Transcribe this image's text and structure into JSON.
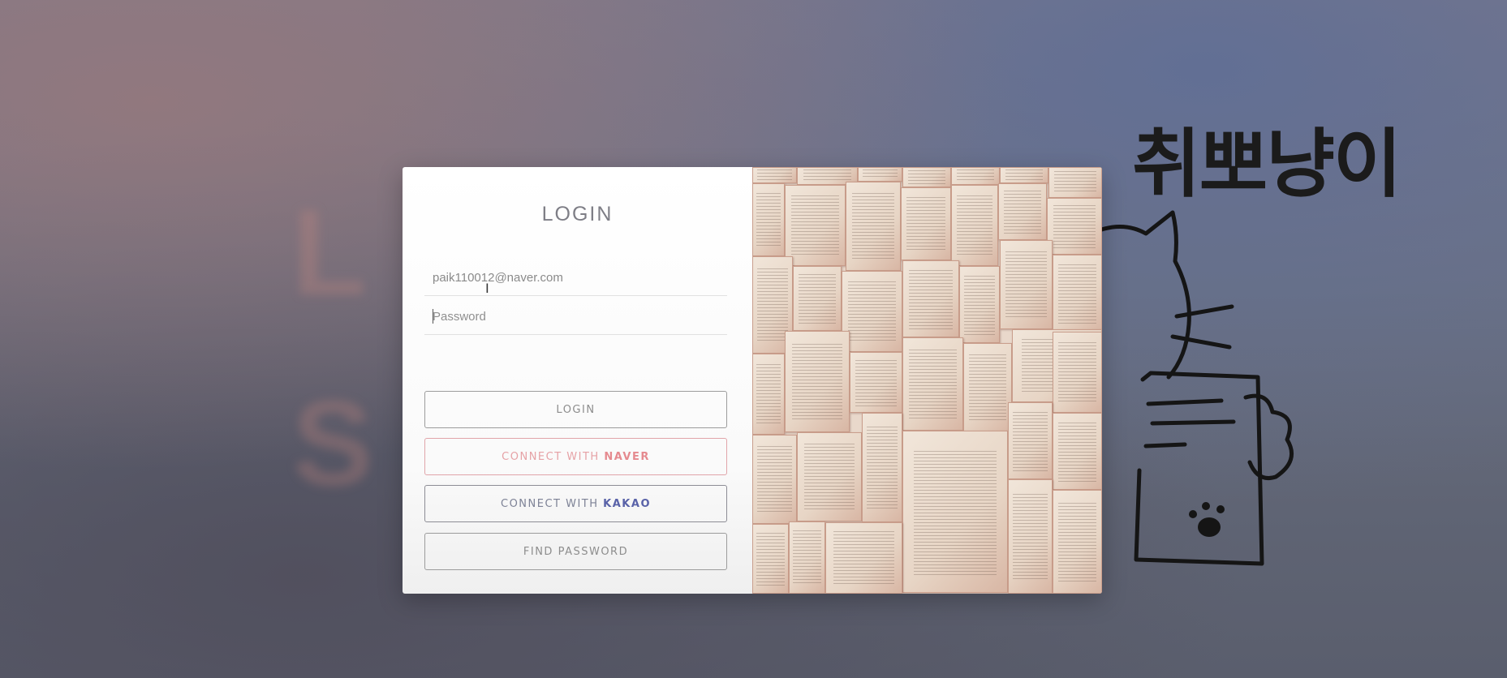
{
  "brand": {
    "title": "취뽀냥이"
  },
  "login_form": {
    "title": "LOGIN",
    "email_value": "paik110012@naver.com",
    "password_placeholder": "Password",
    "buttons": {
      "login": "LOGIN",
      "connect_with": "CONNECT WITH",
      "naver": "NAVER",
      "kakao": "KAKAO",
      "find_password": "FIND PASSWORD"
    }
  },
  "colors": {
    "naver_accent": "#e58a8f",
    "kakao_accent": "#5962a8",
    "card_background": "#ffffff"
  },
  "icons": {
    "text_cursor": "i-beam-cursor-icon",
    "illustration": "cat-holding-paper-icon",
    "photo": "open-books-image"
  }
}
